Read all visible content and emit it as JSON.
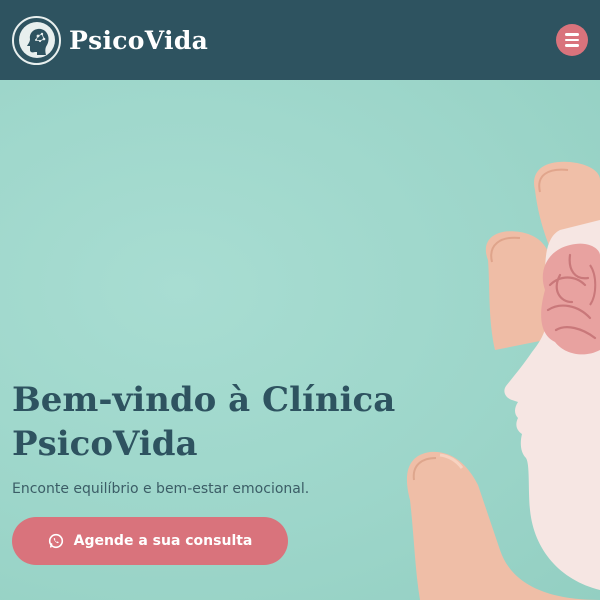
{
  "header": {
    "brand": "PsicoVida",
    "logo_icon": "head-silhouette-icon",
    "menu_icon": "hamburger-menu-icon"
  },
  "hero": {
    "title": "Bem-vindo à Clínica PsicoVida",
    "subtitle": "Enconte equilíbrio e bem-estar emocional.",
    "cta_label": "Agende a sua consulta",
    "cta_icon": "whatsapp-icon",
    "image": "hands-holding-paper-head-with-brain"
  },
  "colors": {
    "header_bg": "#2e5360",
    "accent": "#d9737c",
    "hero_bg": "#9fd8cc",
    "title": "#2e5360"
  }
}
